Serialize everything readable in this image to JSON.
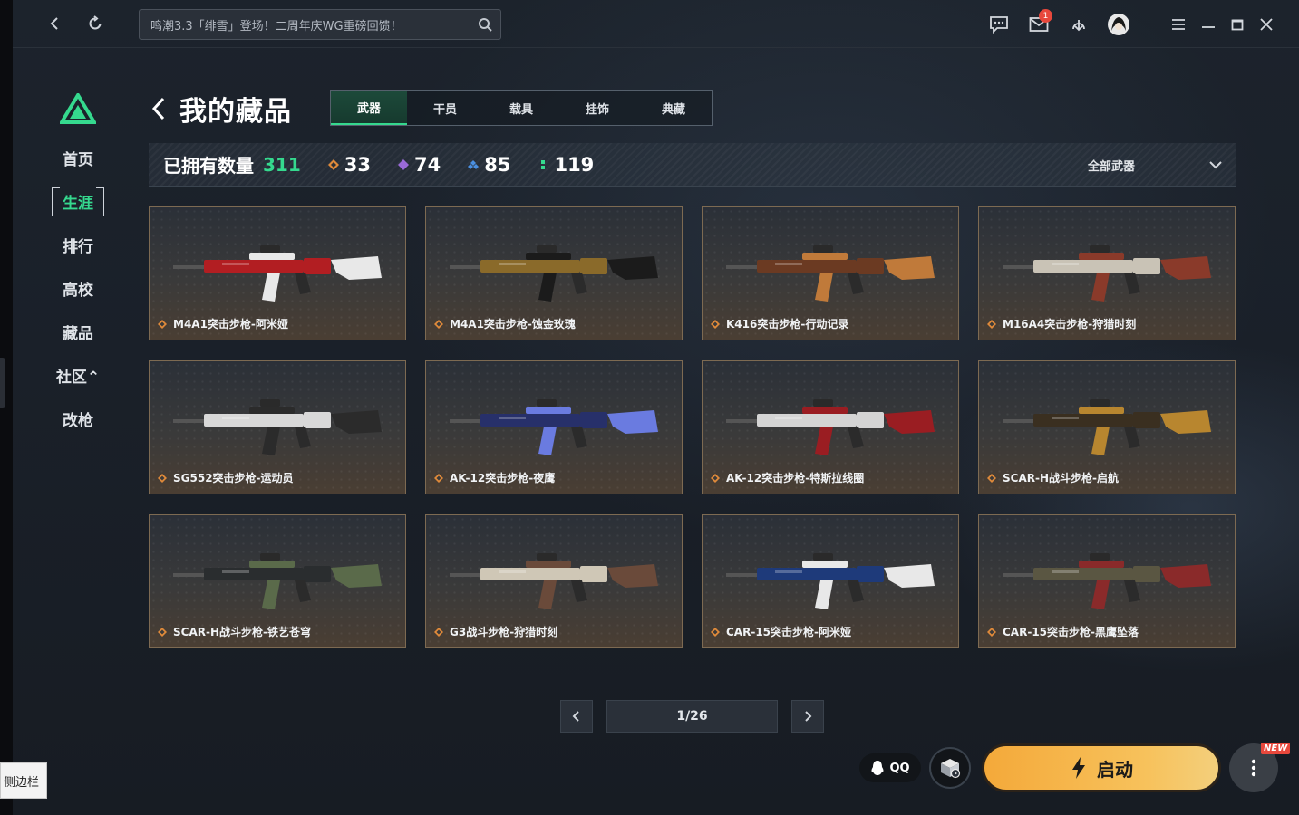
{
  "topbar": {
    "search_text": "鸣潮3.3「绯雪」登场！二周年庆WG重磅回馈！",
    "mail_badge": "1",
    "icons": [
      "back-icon",
      "refresh-icon",
      "search-icon",
      "message-icon",
      "mail-icon",
      "download-icon",
      "avatar-icon",
      "menu-icon",
      "minimize-icon",
      "restore-icon",
      "close-icon"
    ]
  },
  "sidebar": {
    "items": [
      {
        "label": "首页"
      },
      {
        "label": "生涯",
        "active": true
      },
      {
        "label": "排行"
      },
      {
        "label": "高校"
      },
      {
        "label": "藏品"
      },
      {
        "label": "社区⌃"
      },
      {
        "label": "改枪"
      }
    ]
  },
  "header": {
    "title": "我的藏品",
    "tabs": [
      {
        "label": "武器",
        "active": true
      },
      {
        "label": "干员"
      },
      {
        "label": "载具"
      },
      {
        "label": "挂饰"
      },
      {
        "label": "典藏"
      }
    ]
  },
  "stats": {
    "owned_label": "已拥有数量",
    "owned_total": "311",
    "rarities": [
      {
        "count": "33",
        "color": "#e08a3a"
      },
      {
        "count": "74",
        "color": "#9a6ad8"
      },
      {
        "count": "85",
        "color": "#4a8fe0"
      },
      {
        "count": "119",
        "color": "#35d98e"
      }
    ],
    "filter_label": "全部武器"
  },
  "weapons": [
    {
      "name": "M4A1突击步枪-阿米娅",
      "main": "#b21e22",
      "accent": "#e8e8e8"
    },
    {
      "name": "M4A1突击步枪-蚀金玫瑰",
      "main": "#8a6a2a",
      "accent": "#1b1b1b"
    },
    {
      "name": "K416突击步枪-行动记录",
      "main": "#6b3a22",
      "accent": "#c07a3a"
    },
    {
      "name": "M16A4突击步枪-狩猎时刻",
      "main": "#c9c3b6",
      "accent": "#8a3a2a"
    },
    {
      "name": "SG552突击步枪-运动员",
      "main": "#d8d8d8",
      "accent": "#2b2b2b"
    },
    {
      "name": "AK-12突击步枪-夜鹰",
      "main": "#27306a",
      "accent": "#6a7be0"
    },
    {
      "name": "AK-12突击步枪-特斯拉线圈",
      "main": "#d4d4d4",
      "accent": "#9a1d22"
    },
    {
      "name": "SCAR-H战斗步枪-启航",
      "main": "#3a2f20",
      "accent": "#b8862f"
    },
    {
      "name": "SCAR-H战斗步枪-铁艺苍穹",
      "main": "#2a2d2f",
      "accent": "#5a6a4a"
    },
    {
      "name": "G3战斗步枪-狩猎时刻",
      "main": "#cfc7b6",
      "accent": "#6a4a3a"
    },
    {
      "name": "CAR-15突击步枪-阿米娅",
      "main": "#1e3a7a",
      "accent": "#e8e8e8"
    },
    {
      "name": "CAR-15突击步枪-黑鹰坠落",
      "main": "#5a5642",
      "accent": "#8a2a2a"
    }
  ],
  "pagination": {
    "page": "1/26"
  },
  "bottom": {
    "qq_label": "QQ",
    "launch_label": "启动",
    "new_tag": "NEW"
  },
  "sidebar_tip": "侧边栏"
}
